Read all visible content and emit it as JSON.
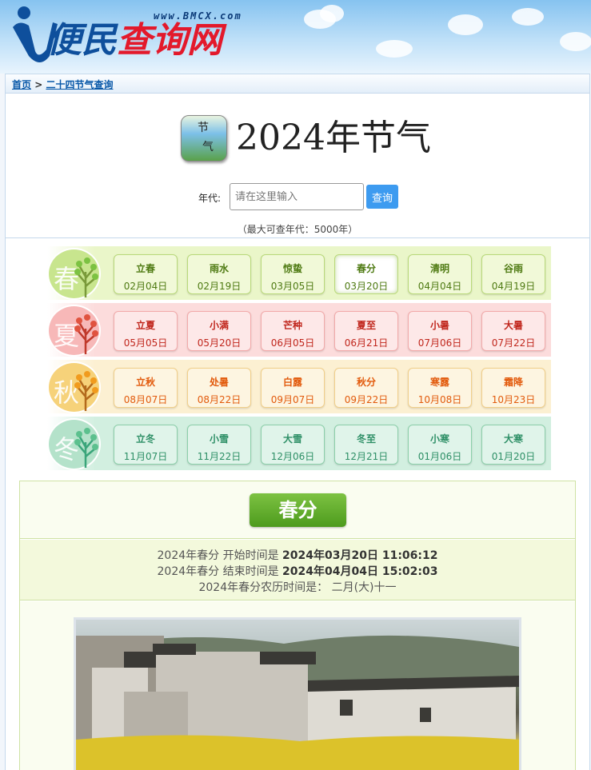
{
  "header": {
    "logo_url": "www.BMCX.com",
    "logo_text_a": "便民",
    "logo_text_b": "查询网"
  },
  "breadcrumb": {
    "home": "首页",
    "separator": ">",
    "current": "二十四节气查询"
  },
  "title": {
    "icon_chars": [
      "节",
      "气"
    ],
    "text": "2024年节气"
  },
  "search": {
    "label": "年代:",
    "placeholder": "请在这里输入",
    "button": "查询",
    "note": "（最大可查年代：5000年）"
  },
  "seasons": [
    {
      "name": "春",
      "row_bg": "#eaf6c9",
      "badge_bg": "#c8e58e",
      "term_bg": "#f1f9d8",
      "term_border": "#b9d97a",
      "term_color": "#4e7a12",
      "terms": [
        {
          "name": "立春",
          "date": "02月04日"
        },
        {
          "name": "雨水",
          "date": "02月19日"
        },
        {
          "name": "惊蛰",
          "date": "03月05日"
        },
        {
          "name": "春分",
          "date": "03月20日",
          "selected": true
        },
        {
          "name": "清明",
          "date": "04月04日"
        },
        {
          "name": "谷雨",
          "date": "04月19日"
        }
      ]
    },
    {
      "name": "夏",
      "row_bg": "#fcdcdc",
      "badge_bg": "#f7b8b8",
      "term_bg": "#fde8e8",
      "term_border": "#f2aaaa",
      "term_color": "#c0261c",
      "terms": [
        {
          "name": "立夏",
          "date": "05月05日"
        },
        {
          "name": "小满",
          "date": "05月20日"
        },
        {
          "name": "芒种",
          "date": "06月05日"
        },
        {
          "name": "夏至",
          "date": "06月21日"
        },
        {
          "name": "小暑",
          "date": "07月06日"
        },
        {
          "name": "大暑",
          "date": "07月22日"
        }
      ]
    },
    {
      "name": "秋",
      "row_bg": "#fcf0d2",
      "badge_bg": "#f6d27a",
      "term_bg": "#fdf5e1",
      "term_border": "#f1cf8a",
      "term_color": "#e25a0c",
      "terms": [
        {
          "name": "立秋",
          "date": "08月07日"
        },
        {
          "name": "处暑",
          "date": "08月22日"
        },
        {
          "name": "白露",
          "date": "09月07日"
        },
        {
          "name": "秋分",
          "date": "09月22日"
        },
        {
          "name": "寒露",
          "date": "10月08日"
        },
        {
          "name": "霜降",
          "date": "10月23日"
        }
      ]
    },
    {
      "name": "冬",
      "row_bg": "#d2efe0",
      "badge_bg": "#b4e2ca",
      "term_bg": "#e0f4ea",
      "term_border": "#8ccfaa",
      "term_color": "#2d8f66",
      "terms": [
        {
          "name": "立冬",
          "date": "11月07日"
        },
        {
          "name": "小雪",
          "date": "11月22日"
        },
        {
          "name": "大雪",
          "date": "12月06日"
        },
        {
          "name": "冬至",
          "date": "12月21日"
        },
        {
          "name": "小寒",
          "date": "01月06日"
        },
        {
          "name": "大寒",
          "date": "01月20日"
        }
      ]
    }
  ],
  "detail": {
    "title": "春分",
    "start_prefix": "2024年春分 开始时间是",
    "start_value": "2024年03月20日 11:06:12",
    "end_prefix": "2024年春分 结束时间是",
    "end_value": "2024年04月04日 15:02:03",
    "lunar_line": "2024年春分农历时间是：  二月(大)十一"
  }
}
